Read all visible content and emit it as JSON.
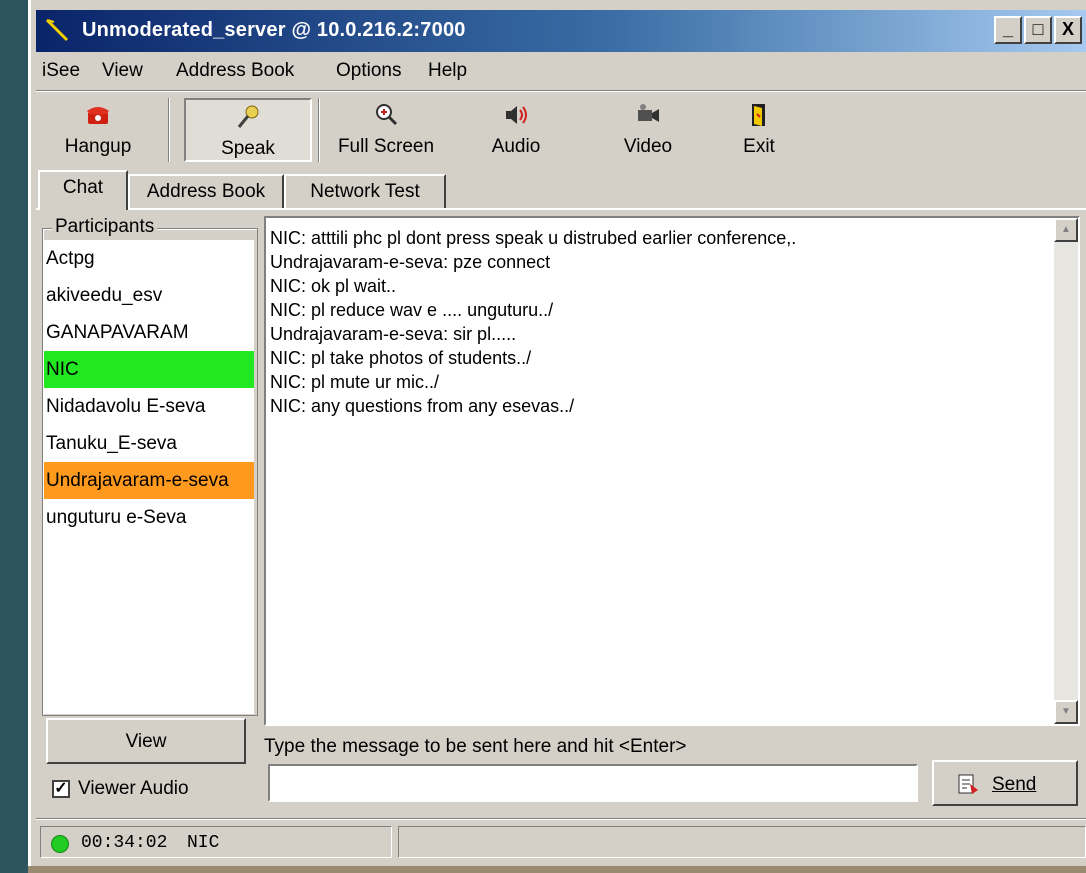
{
  "window": {
    "title": "Unmoderated_server @ 10.0.216.2:7000",
    "buttons": {
      "minimize": "_",
      "maximize": "□",
      "close": "X"
    }
  },
  "menu": [
    "iSee",
    "View",
    "Address Book",
    "Options",
    "Help"
  ],
  "toolbar": {
    "hangup": "Hangup",
    "speak": "Speak",
    "fullscreen": "Full Screen",
    "audio": "Audio",
    "video": "Video",
    "exit": "Exit"
  },
  "tabs": [
    "Chat",
    "Address Book",
    "Network Test"
  ],
  "participants": {
    "title": "Participants",
    "items": [
      {
        "name": "Actpg",
        "highlight": ""
      },
      {
        "name": "akiveedu_esv",
        "highlight": ""
      },
      {
        "name": "GANAPAVARAM",
        "highlight": ""
      },
      {
        "name": "NIC",
        "highlight": "#22e822"
      },
      {
        "name": "Nidadavolu E-seva",
        "highlight": ""
      },
      {
        "name": "Tanuku_E-seva",
        "highlight": ""
      },
      {
        "name": "Undrajavaram-e-seva",
        "highlight": "#ff9a1e"
      },
      {
        "name": "unguturu e-Seva",
        "highlight": ""
      }
    ],
    "view_button": "View",
    "viewer_audio": "Viewer Audio",
    "viewer_audio_checked": true
  },
  "chat": {
    "lines": [
      "NIC: atttili  phc pl dont press speak u distrubed earlier conference,.",
      "Undrajavaram-e-seva: pze connect",
      "NIC: ok pl wait..",
      "NIC: pl reduce wav e  .... unguturu../",
      "Undrajavaram-e-seva: sir pl.....",
      "NIC: pl take photos of students../",
      "NIC: pl mute ur mic../",
      "NIC: any questions  from any esevas../"
    ],
    "hint": "Type the message to be sent here and hit <Enter>",
    "input_value": "",
    "send_label": "Send"
  },
  "status": {
    "time": "00:34:02",
    "user": "NIC",
    "led_color": "#22cc22"
  }
}
